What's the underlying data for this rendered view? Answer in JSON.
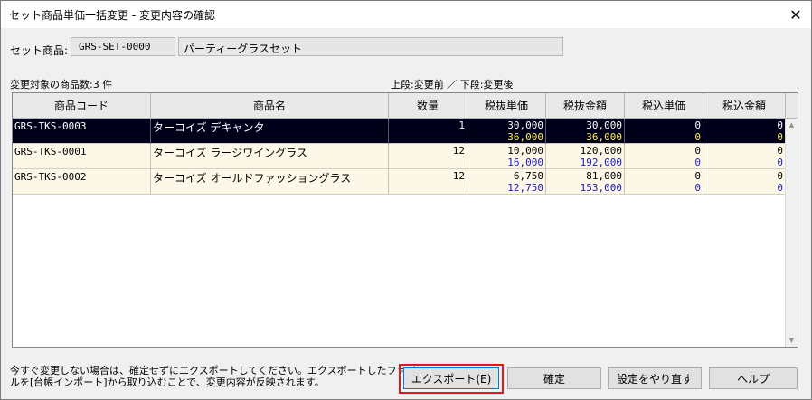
{
  "window": {
    "title": "セット商品単価一括変更 - 変更内容の確認",
    "close_symbol": "✕"
  },
  "set_product": {
    "label": "セット商品:",
    "code": "GRS-SET-0000",
    "name": "パーティーグラスセット"
  },
  "count_label": "変更対象の商品数:3 件",
  "legend_label": "上段:変更前 ／ 下段:変更後",
  "table": {
    "columns": [
      "商品コード",
      "商品名",
      "数量",
      "税抜単価",
      "税抜金額",
      "税込単価",
      "税込金額"
    ],
    "rows": [
      {
        "code": "GRS-TKS-0003",
        "name": "ターコイズ デキャンタ",
        "qty": "1",
        "tax_excl_unit": {
          "before": "30,000",
          "after": "36,000"
        },
        "tax_excl_amount": {
          "before": "30,000",
          "after": "36,000"
        },
        "tax_incl_unit": {
          "before": "0",
          "after": "0"
        },
        "tax_incl_amount": {
          "before": "0",
          "after": "0"
        }
      },
      {
        "code": "GRS-TKS-0001",
        "name": "ターコイズ ラージワイングラス",
        "qty": "12",
        "tax_excl_unit": {
          "before": "10,000",
          "after": "16,000"
        },
        "tax_excl_amount": {
          "before": "120,000",
          "after": "192,000"
        },
        "tax_incl_unit": {
          "before": "0",
          "after": "0"
        },
        "tax_incl_amount": {
          "before": "0",
          "after": "0"
        }
      },
      {
        "code": "GRS-TKS-0002",
        "name": "ターコイズ オールドファッショングラス",
        "qty": "12",
        "tax_excl_unit": {
          "before": "6,750",
          "after": "12,750"
        },
        "tax_excl_amount": {
          "before": "81,000",
          "after": "153,000"
        },
        "tax_incl_unit": {
          "before": "0",
          "after": "0"
        },
        "tax_incl_amount": {
          "before": "0",
          "after": "0"
        }
      }
    ]
  },
  "note": {
    "line1": "今すぐ変更しない場合は、確定せずにエクスポートしてください。エクスポートしたファイ",
    "line2": "ルを[台帳インポート]から取り込むことで、変更内容が反映されます。"
  },
  "buttons": {
    "export": "エクスポート(E)",
    "confirm": "確定",
    "reset": "設定をやり直す",
    "help": "ヘルプ"
  },
  "scrollbar": {
    "up_symbol": "▲",
    "down_symbol": "▼"
  },
  "colors": {
    "highlight": "#e8141e",
    "selected_row_bg": "#00001a",
    "after_value_text": "#1a1ab8",
    "selected_after_value_text": "#ffee55"
  }
}
